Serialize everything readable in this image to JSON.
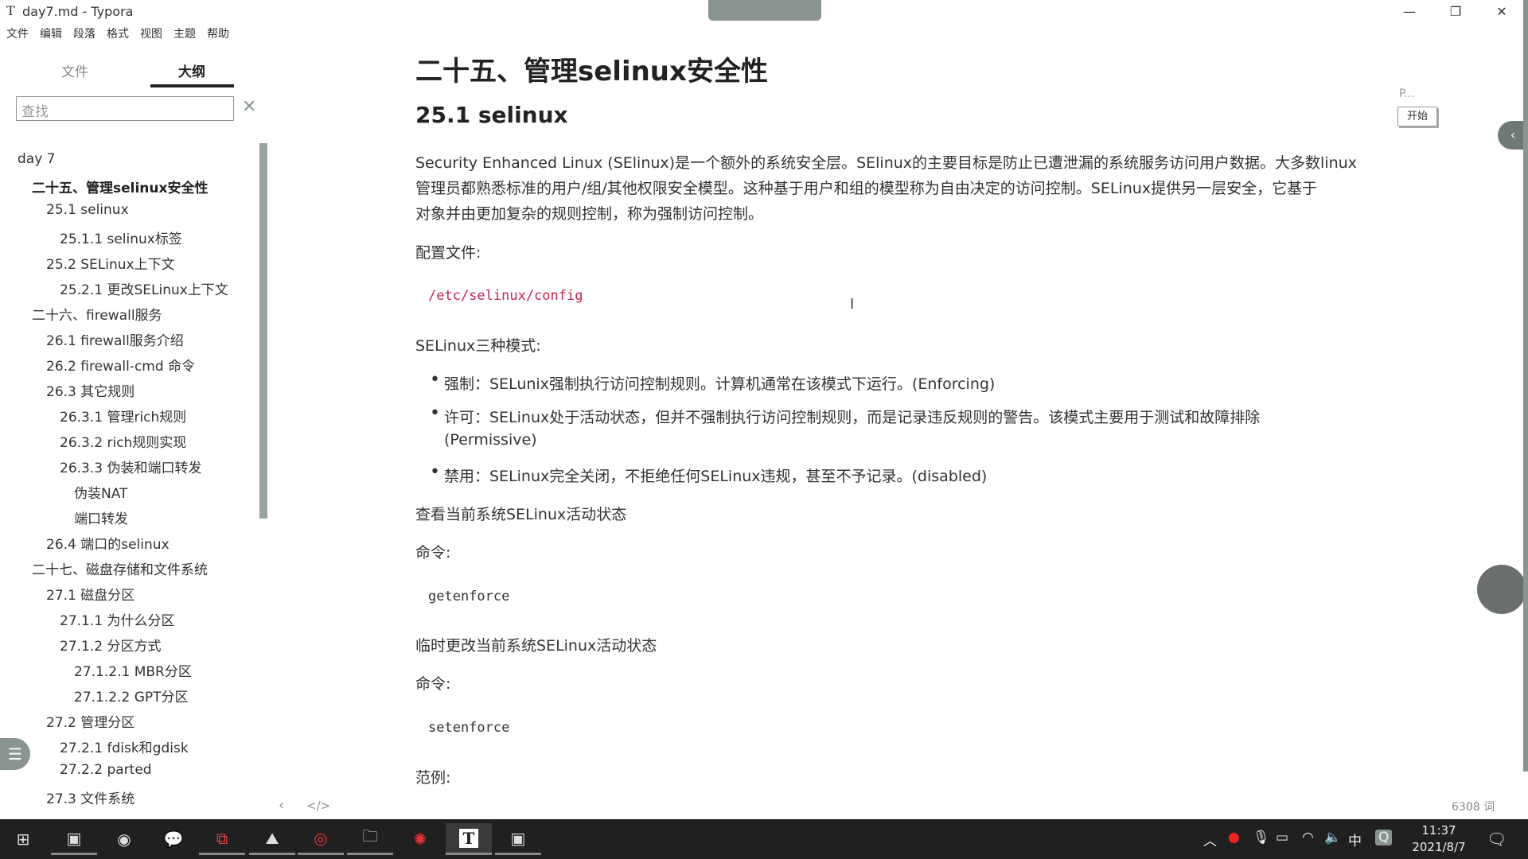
{
  "window": {
    "title": "day7.md - Typora",
    "app_icon": "T"
  },
  "menu": [
    "文件",
    "编辑",
    "段落",
    "格式",
    "视图",
    "主题",
    "帮助"
  ],
  "sidebar": {
    "tabs": [
      "文件",
      "大纲"
    ],
    "active_tab": "大纲",
    "search_placeholder": "查找",
    "outline": [
      {
        "label": "day 7",
        "level": 0
      },
      {
        "label": "二十五、管理selinux安全性",
        "level": 1,
        "active": true
      },
      {
        "label": "25.1 selinux",
        "level": 2
      },
      {
        "label": "25.1.1 selinux标签",
        "level": 3
      },
      {
        "label": "25.2 SELinux上下文",
        "level": 2
      },
      {
        "label": "25.2.1 更改SELinux上下文",
        "level": 3
      },
      {
        "label": "二十六、firewall服务",
        "level": 1
      },
      {
        "label": "26.1 firewall服务介绍",
        "level": 2
      },
      {
        "label": "26.2 firewall-cmd 命令",
        "level": 2
      },
      {
        "label": "26.3 其它规则",
        "level": 2
      },
      {
        "label": "26.3.1 管理rich规则",
        "level": 3
      },
      {
        "label": "26.3.2 rich规则实现",
        "level": 3
      },
      {
        "label": "26.3.3 伪装和端口转发",
        "level": 3
      },
      {
        "label": "伪装NAT",
        "level": 4
      },
      {
        "label": "端口转发",
        "level": 4
      },
      {
        "label": "26.4 端口的selinux",
        "level": 2
      },
      {
        "label": "二十七、磁盘存储和文件系统",
        "level": 1
      },
      {
        "label": "27.1 磁盘分区",
        "level": 2
      },
      {
        "label": "27.1.1 为什么分区",
        "level": 3
      },
      {
        "label": "27.1.2 分区方式",
        "level": 3
      },
      {
        "label": "27.1.2.1 MBR分区",
        "level": 4
      },
      {
        "label": "27.1.2.2 GPT分区",
        "level": 4
      },
      {
        "label": "27.2 管理分区",
        "level": 2
      },
      {
        "label": "27.2.1 fdisk和gdisk",
        "level": 3
      },
      {
        "label": "27.2.2 parted",
        "level": 3
      },
      {
        "label": "27.3 文件系统",
        "level": 2
      }
    ],
    "footer_icons": [
      "chevron-left-icon",
      "source-code-icon"
    ]
  },
  "doc": {
    "h1": "二十五、管理selinux安全性",
    "h2": "25.1 selinux",
    "intro": [
      "Security Enhanced Linux (SElinux)是一个额外的系统安全层。SElinux的主要目标是防止已遭泄漏的系统服务访问用户数据。大多数linux",
      "管理员都熟悉标准的用户/组/其他权限安全模型。这种基于用户和组的模型称为自由决定的访问控制。SELinux提供另一层安全，它基于",
      "对象并由更加复杂的规则控制，称为强制访问控制。"
    ],
    "config_label": "配置文件:",
    "config_path": "/etc/selinux/config",
    "modes_label": "SELinux三种模式:",
    "modes": [
      "强制：SELunix强制执行访问控制规则。计算机通常在该模式下运行。(Enforcing)",
      "许可：SELinux处于活动状态，但并不强制执行访问控制规则，而是记录违反规则的警告。该模式主要用于测试和故障排除",
      "(Permissive)",
      "禁用：SELinux完全关闭，不拒绝任何SELinux违规，甚至不予记录。(disabled)"
    ],
    "view_label": "查看当前系统SELinux活动状态",
    "cmd_label": "命令:",
    "cmd1": "getenforce",
    "change_label": "临时更改当前系统SELinux活动状态",
    "cmd2": "setenforce",
    "example_label": "范例:",
    "word_count": "6308 词"
  },
  "overlay": {
    "title": "P...",
    "start_button": "开始"
  },
  "taskbar": {
    "time": "11:37",
    "date": "2021/8/7",
    "ime": "中",
    "active_app": "Typora",
    "accent": "#202020"
  }
}
